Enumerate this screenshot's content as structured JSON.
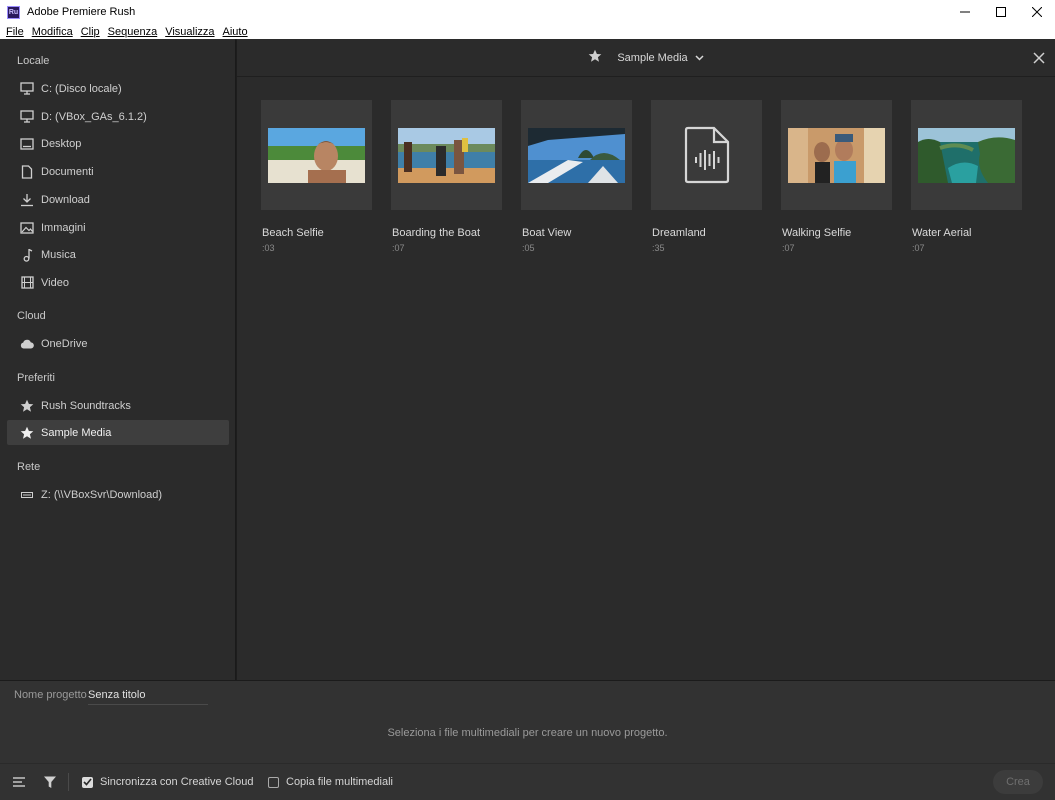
{
  "window": {
    "title": "Adobe Premiere Rush",
    "app_icon_text": "Ru"
  },
  "menu": [
    "File",
    "Modifica",
    "Clip",
    "Sequenza",
    "Visualizza",
    "Aiuto"
  ],
  "sidebar": {
    "sections": [
      {
        "title": "Locale",
        "items": [
          {
            "label": "C: (Disco locale)",
            "icon": "monitor-icon"
          },
          {
            "label": "D: (VBox_GAs_6.1.2)",
            "icon": "monitor-icon"
          },
          {
            "label": "Desktop",
            "icon": "desktop-icon"
          },
          {
            "label": "Documenti",
            "icon": "document-icon"
          },
          {
            "label": "Download",
            "icon": "download-icon"
          },
          {
            "label": "Immagini",
            "icon": "image-icon"
          },
          {
            "label": "Musica",
            "icon": "music-icon"
          },
          {
            "label": "Video",
            "icon": "film-icon"
          }
        ]
      },
      {
        "title": "Cloud",
        "items": [
          {
            "label": "OneDrive",
            "icon": "cloud-icon"
          }
        ]
      },
      {
        "title": "Preferiti",
        "items": [
          {
            "label": "Rush Soundtracks",
            "icon": "star-icon"
          },
          {
            "label": "Sample Media",
            "icon": "star-icon",
            "active": true
          }
        ]
      },
      {
        "title": "Rete",
        "items": [
          {
            "label": "Z: (\\\\VBoxSvr\\Download)",
            "icon": "network-drive-icon"
          }
        ]
      }
    ]
  },
  "header": {
    "location": "Sample Media"
  },
  "media": [
    {
      "name": "Beach Selfie",
      "duration": ":03",
      "thumb": "photo"
    },
    {
      "name": "Boarding the Boat",
      "duration": ":07",
      "thumb": "photo"
    },
    {
      "name": "Boat View",
      "duration": ":05",
      "thumb": "photo"
    },
    {
      "name": "Dreamland",
      "duration": ":35",
      "thumb": "audio"
    },
    {
      "name": "Walking Selfie",
      "duration": ":07",
      "thumb": "photo"
    },
    {
      "name": "Water Aerial",
      "duration": ":07",
      "thumb": "photo"
    }
  ],
  "project": {
    "name_label": "Nome progetto",
    "name_value": "Senza titolo",
    "hint": "Seleziona i file multimediali per creare un nuovo progetto."
  },
  "footer": {
    "sync_label": "Sincronizza con Creative Cloud",
    "sync_checked": true,
    "copy_label": "Copia file multimediali",
    "copy_checked": false,
    "create_label": "Crea"
  },
  "colors": {
    "sidebar_bg": "#2b2b2b",
    "active_item_bg": "#3e3e3e",
    "card_bg": "#3a3a3a",
    "bottom_bg": "#323232"
  }
}
